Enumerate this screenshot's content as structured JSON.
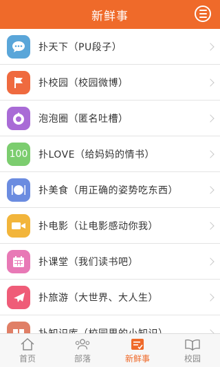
{
  "header": {
    "title": "新鲜事"
  },
  "items": [
    {
      "label": "扑天下（PU段子）",
      "color": "#5aa6d9",
      "icon": "speech-bubble-icon"
    },
    {
      "label": "扑校园（校园微博）",
      "color": "#ef6a3f",
      "icon": "flag-icon"
    },
    {
      "label": "泡泡圈（匿名吐槽）",
      "color": "#a96bd6",
      "icon": "bubble-circle-icon"
    },
    {
      "label": "扑LOVE（给妈妈的情书）",
      "color": "#7ccd6f",
      "icon": "hundred-icon",
      "icon_text": "100"
    },
    {
      "label": "扑美食（用正确的姿势吃东西）",
      "color": "#6b8ce0",
      "icon": "dining-icon"
    },
    {
      "label": "扑电影（让电影感动你我）",
      "color": "#f2b53b",
      "icon": "video-camera-icon"
    },
    {
      "label": "扑课堂（我们读书吧）",
      "color": "#e879b6",
      "icon": "calendar-icon"
    },
    {
      "label": "扑旅游（大世界、大人生）",
      "color": "#ef5c78",
      "icon": "airplane-icon"
    },
    {
      "label": "扑知识库（校园里的小知识）",
      "color": "#e07f66",
      "icon": "book-icon"
    }
  ],
  "tabs": [
    {
      "label": "首页",
      "icon": "home-icon",
      "active": false
    },
    {
      "label": "部落",
      "icon": "group-icon",
      "active": false
    },
    {
      "label": "新鲜事",
      "icon": "news-icon",
      "active": true
    },
    {
      "label": "校园",
      "icon": "book-open-icon",
      "active": false
    }
  ],
  "colors": {
    "accent": "#ef6a2a"
  }
}
